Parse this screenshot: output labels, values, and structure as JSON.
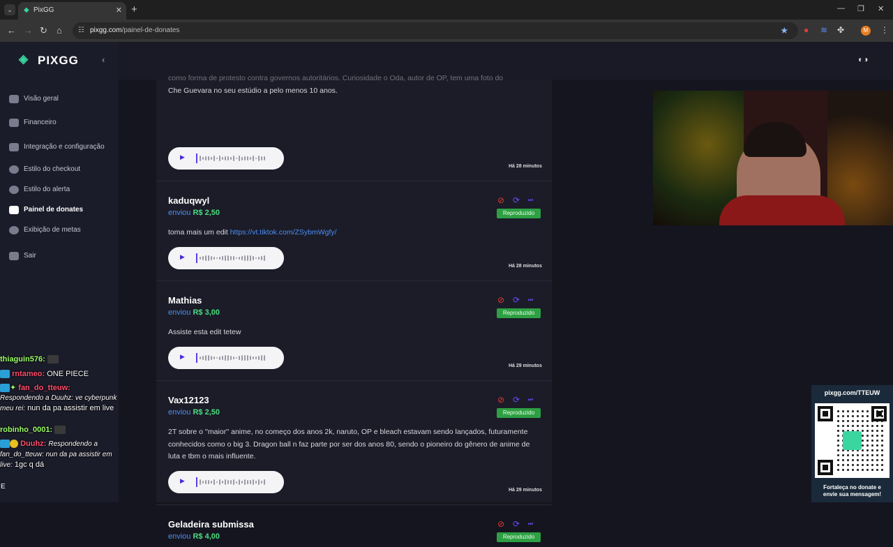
{
  "browser": {
    "tab_title": "PixGG",
    "url_host": "pixgg.com",
    "url_path": "/painel-de-donates",
    "profile_initial": "M"
  },
  "sidebar": {
    "logo_text": "PIXGG",
    "items": [
      {
        "label": "Visão geral"
      },
      {
        "label": "Financeiro"
      },
      {
        "label": "Integração e configuração"
      },
      {
        "label": "Estilo do checkout"
      },
      {
        "label": "Estilo do alerta"
      },
      {
        "label": "Painel de donates"
      },
      {
        "label": "Exibição de metas"
      },
      {
        "label": "Sair"
      }
    ]
  },
  "donations": [
    {
      "username": "",
      "sent_label": "",
      "amount": "",
      "message_lines": [
        "como forma de protesto contra governos autoritários. Curiosidade o Oda, autor de OP, tem uma foto do",
        "Che Guevara no seu estúdio a pelo menos 10 anos."
      ],
      "time": "Há 28 minutos",
      "status": ""
    },
    {
      "username": "kaduqwyl",
      "sent_label": "enviou",
      "amount": "R$ 2,50",
      "message": "toma mais um edit ",
      "link": "https://vt.tiktok.com/ZSybmWgfy/",
      "time": "Há 28 minutos",
      "status": "Reproduzido"
    },
    {
      "username": "Mathias",
      "sent_label": "enviou",
      "amount": "R$ 3,00",
      "message": "Assiste esta edit tetew",
      "time": "Há 29 minutos",
      "status": "Reproduzido"
    },
    {
      "username": "Vax12123",
      "sent_label": "enviou",
      "amount": "R$ 2,50",
      "message": "2T sobre o ''maior'' anime, no começo dos anos 2k, naruto, OP e bleach estavam sendo lançados, futuramente conhecidos como o big 3. Dragon ball n faz parte por ser dos anos 80, sendo o pioneiro do gênero de anime de luta e tbm o mais influente.",
      "time": "Há 29 minutos",
      "status": "Reproduzido"
    },
    {
      "username": "Geladeira submissa",
      "sent_label": "enviou",
      "amount": "R$ 4,00",
      "status": "Reproduzido"
    }
  ],
  "chat": [
    {
      "user": "thiaguin576:",
      "text": ""
    },
    {
      "user": "rntameo:",
      "text": "ONE PIECE"
    },
    {
      "user": "fan_do_tteuw:",
      "text": ""
    },
    {
      "reply": "Respondendo a Duuhz: ve cyberpunk meu rei:",
      "text": "nun da pa assistir em live"
    },
    {
      "user": "robinho_0001:",
      "text": ""
    },
    {
      "user": "Duuhz:",
      "reply": "Respondendo a fan_do_tteuw: nun da pa assistir em live:",
      "text": "1gc q dá"
    },
    {
      "text": "E"
    }
  ],
  "qr": {
    "url": "pixgg.com/TTEUW",
    "caption_1": "Fortaleça no donate e",
    "caption_2": "envie sua mensagem!"
  }
}
